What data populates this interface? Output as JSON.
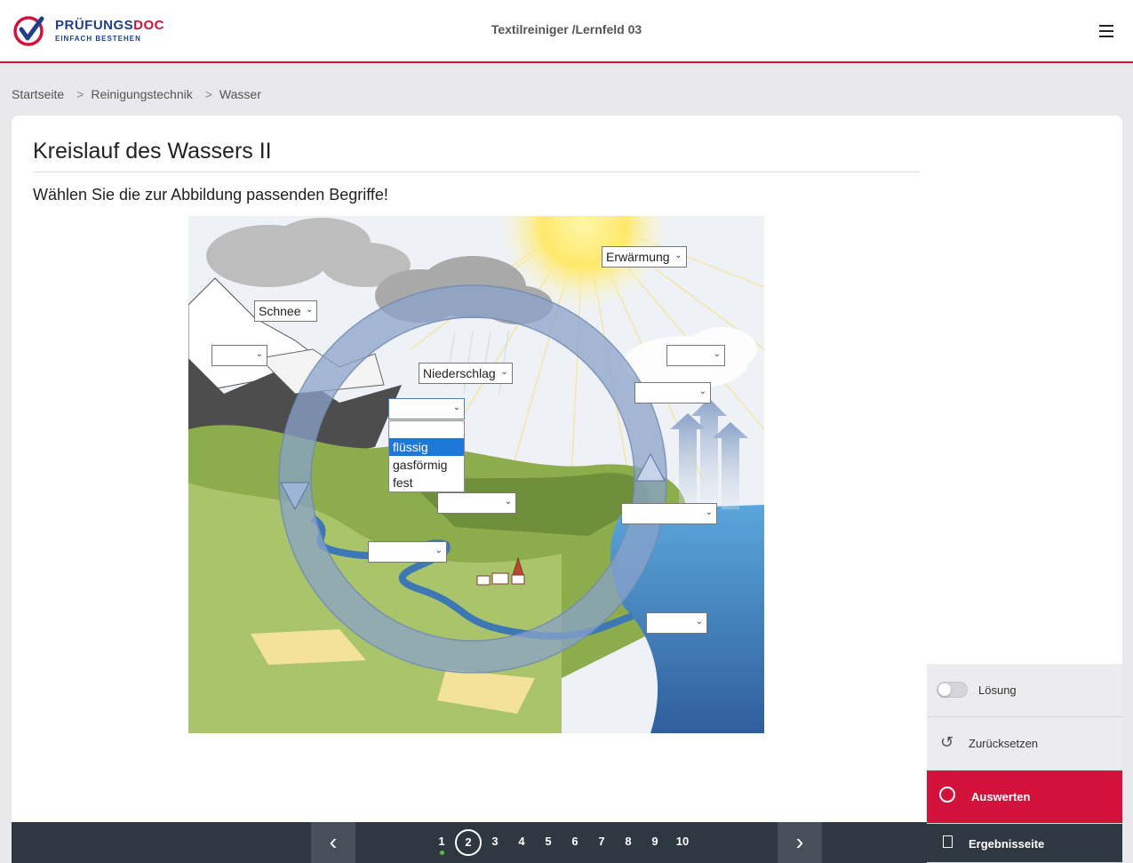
{
  "header": {
    "logo_primary": "PRÜFUNGS",
    "logo_accent": "DOC",
    "logo_tagline": "EINFACH BESTEHEN",
    "course_title": "Textilreiniger /Lernfeld 03"
  },
  "breadcrumb": [
    "Startseite",
    "Reinigungstechnik",
    "Wasser"
  ],
  "task": {
    "title": "Kreislauf des Wassers II",
    "instruction": "Wählen Sie die zur Abbildung passenden Begriffe!"
  },
  "figure": {
    "selects": {
      "erwaermung": "Erwärmung",
      "schnee": "Schnee",
      "niederschlag": "Niederschlag",
      "empty": ""
    },
    "open_dropdown": {
      "options": [
        "flüssig",
        "gasförmig",
        "fest"
      ],
      "highlighted": "flüssig"
    }
  },
  "side_panel": {
    "solution_label": "Lösung",
    "reset_label": "Zurücksetzen",
    "evaluate_label": "Auswerten",
    "results_label": "Ergebnisseite"
  },
  "pagination": {
    "pages": [
      "1",
      "2",
      "3",
      "4",
      "5",
      "6",
      "7",
      "8",
      "9",
      "10"
    ],
    "current": "2",
    "prev_icon": "chevron-left-icon",
    "next_icon": "chevron-right-icon"
  },
  "colors": {
    "brand_red": "#d2123a",
    "brand_blue": "#1f3f8a",
    "nav_dark": "#2f3740",
    "highlight_blue": "#1e78d7"
  }
}
